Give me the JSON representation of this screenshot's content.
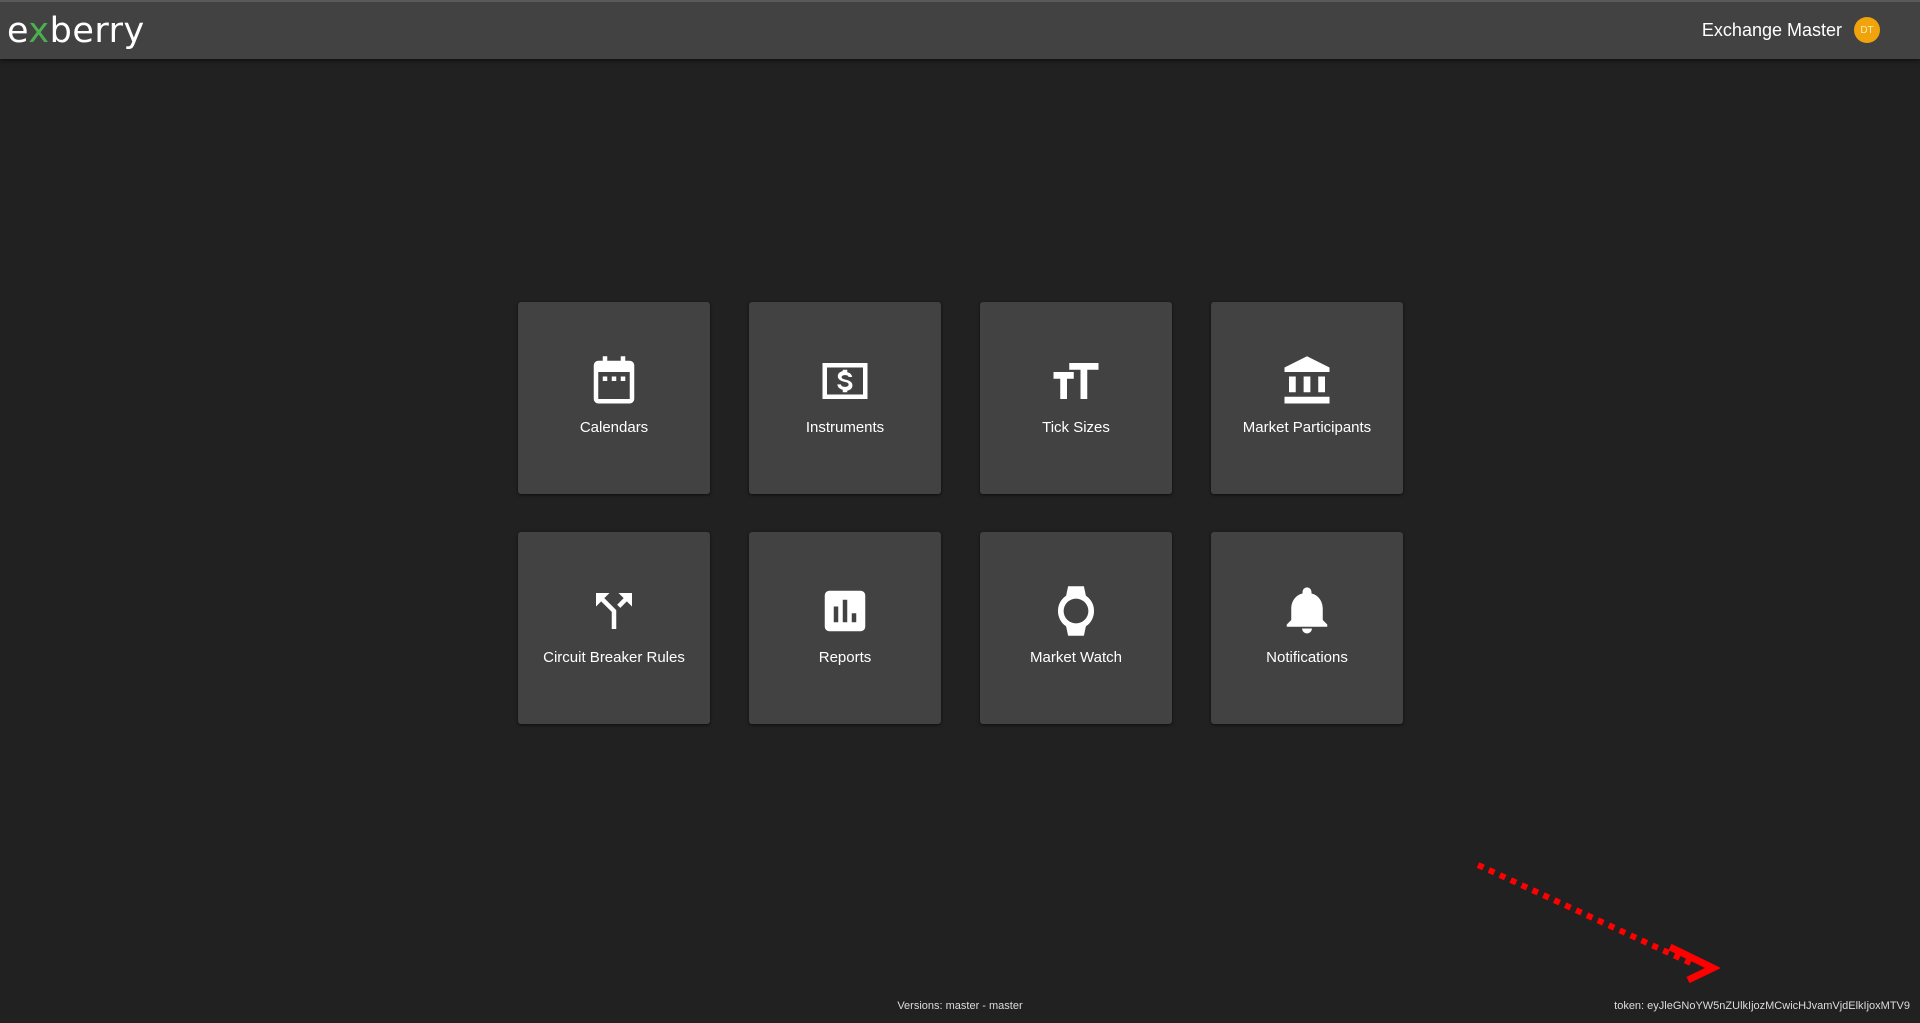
{
  "header": {
    "logo": {
      "part1": "e",
      "x_left": "x",
      "x_right": "",
      "part2": "berry"
    },
    "user_name": "Exchange Master",
    "avatar_initials": "DT",
    "avatar_color": "#f0a30a"
  },
  "tiles": [
    {
      "label": "Calendars",
      "icon": "calendar-icon"
    },
    {
      "label": "Instruments",
      "icon": "dollar-icon"
    },
    {
      "label": "Tick Sizes",
      "icon": "text-size-icon"
    },
    {
      "label": "Market Participants",
      "icon": "bank-icon"
    },
    {
      "label": "Circuit Breaker Rules",
      "icon": "split-arrows-icon"
    },
    {
      "label": "Reports",
      "icon": "bar-chart-icon"
    },
    {
      "label": "Market Watch",
      "icon": "watch-icon"
    },
    {
      "label": "Notifications",
      "icon": "bell-icon"
    }
  ],
  "footer": {
    "version": "Versions: master - master",
    "token": "token: eyJleGNoYW5nZUlkIjozMCwicHJvamVjdElkIjoxMTV9"
  },
  "annotation": {
    "color": "#ff0000",
    "icon": "dotted-arrow-icon"
  }
}
